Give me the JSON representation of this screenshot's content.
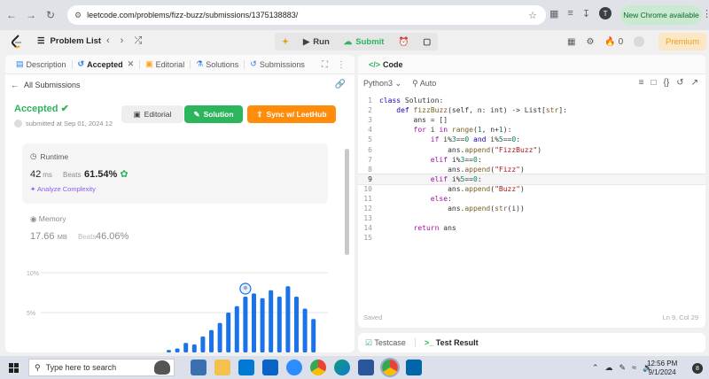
{
  "browser": {
    "url": "leetcode.com/problems/fizz-buzz/submissions/1375138883/",
    "profile_initial": "T",
    "update_label": "New Chrome available"
  },
  "topbar": {
    "problem_list_label": "Problem List",
    "run_label": "Run",
    "submit_label": "Submit",
    "streak_count": "0",
    "premium_label": "Premium"
  },
  "left_tabs": [
    "Description",
    "Accepted",
    "Editorial",
    "Solutions",
    "Submissions"
  ],
  "submission": {
    "back_label": "All Submissions",
    "status": "Accepted",
    "submitted_text": "submitted at Sep 01, 2024 12",
    "editorial_button": "Editorial",
    "solution_button": "Solution",
    "sync_button": "Sync w/ LeetHub"
  },
  "runtime": {
    "label": "Runtime",
    "value": "42",
    "unit": "ms",
    "beats_label": "Beats",
    "beats_pct": "61.54%",
    "analyze_label": "Analyze Complexity"
  },
  "memory": {
    "label": "Memory",
    "value": "17.66",
    "unit": "MB",
    "beats_label": "Beats",
    "beats_pct": "46.06%"
  },
  "chart_data": {
    "type": "bar",
    "ytick_labels": [
      "10%",
      "5%"
    ],
    "ylim": [
      0,
      10
    ],
    "values": [
      0.3,
      0.5,
      1.2,
      1.0,
      2.0,
      2.8,
      3.7,
      5.0,
      5.8,
      7.0,
      7.4,
      6.8,
      7.8,
      7.0,
      8.3,
      7.0,
      5.5,
      4.2
    ],
    "highlight_index": 9,
    "color": "#1a73e8"
  },
  "right_tabs": [
    "Code"
  ],
  "editor": {
    "language": "Python3",
    "mode": "Auto",
    "saved_label": "Saved",
    "cursor_label": "Ln 9, Col 29",
    "current_line": 9,
    "lines": [
      "class Solution:",
      "    def fizzBuzz(self, n: int) -> List[str]:",
      "        ans = []",
      "        for i in range(1, n+1):",
      "            if i%3==0 and i%5==0:",
      "                ans.append(\"FizzBuzz\")",
      "            elif i%3==0:",
      "                ans.append(\"Fizz\")",
      "            elif i%5==0:",
      "                ans.append(\"Buzz\")",
      "            else:",
      "                ans.append(str(i))",
      "",
      "        return ans",
      ""
    ]
  },
  "bottom_tabs": [
    "Testcase",
    "Test Result"
  ],
  "taskbar": {
    "search_placeholder": "Type here to search",
    "time": "12:56 PM",
    "date": "9/1/2024",
    "notification_count": "8"
  },
  "colors": {
    "accent_green": "#2db55d",
    "accent_orange": "#ff8c0a",
    "chart_blue": "#1a73e8"
  }
}
